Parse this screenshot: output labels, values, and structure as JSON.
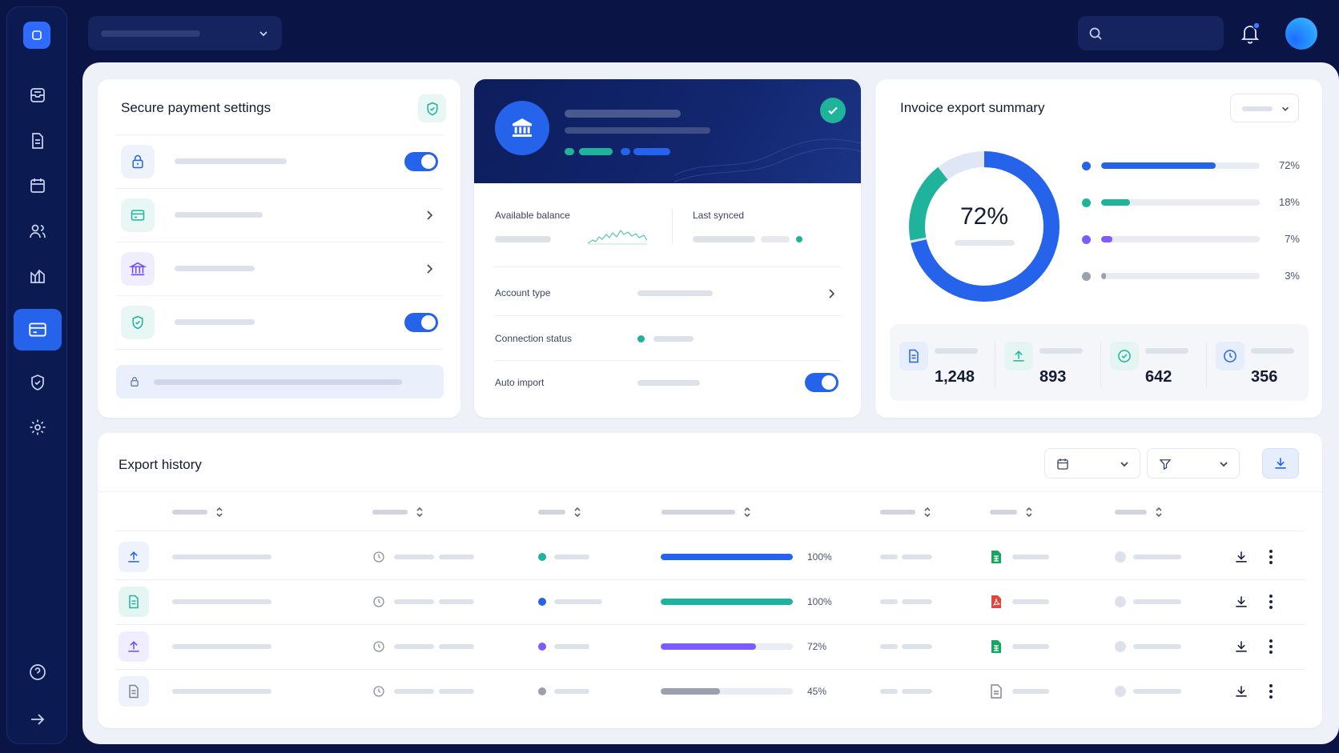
{
  "payment_settings": {
    "title": "Secure payment settings"
  },
  "bank_card": {
    "available_balance_label": "Available balance",
    "last_synced_label": "Last synced",
    "account_type_label": "Account type",
    "connection_status_label": "Connection status",
    "auto_import_label": "Auto import"
  },
  "invoice_summary": {
    "title": "Invoice export summary",
    "center_value": "72%",
    "breakdown": [
      {
        "percent": "72%",
        "value": 72,
        "color": "#2563eb"
      },
      {
        "percent": "18%",
        "value": 18,
        "color": "#20b39b"
      },
      {
        "percent": "7%",
        "value": 7,
        "color": "#7c5cff"
      },
      {
        "percent": "3%",
        "value": 3,
        "color": "#9aa0ae"
      }
    ],
    "stats": [
      {
        "value": "1,248",
        "icon": "document-icon"
      },
      {
        "value": "893",
        "icon": "upload-icon"
      },
      {
        "value": "642",
        "icon": "check-circle-icon"
      },
      {
        "value": "356",
        "icon": "clock-icon"
      }
    ]
  },
  "export_history": {
    "title": "Export history",
    "rows": [
      {
        "progress": "100%",
        "progress_value": 100,
        "color": "#2563eb",
        "status_color": "#20b39b",
        "type_icon": "upload-icon",
        "file_icon": "spreadsheet-icon"
      },
      {
        "progress": "100%",
        "progress_value": 100,
        "color": "#20b39b",
        "status_color": "#2563eb",
        "type_icon": "document-icon",
        "file_icon": "pdf-icon"
      },
      {
        "progress": "72%",
        "progress_value": 72,
        "color": "#7c5cff",
        "status_color": "#7c5cff",
        "type_icon": "upload-icon",
        "file_icon": "spreadsheet-icon"
      },
      {
        "progress": "45%",
        "progress_value": 45,
        "color": "#9aa0ae",
        "status_color": "#9aa0ae",
        "type_icon": "document-icon",
        "file_icon": "file-icon"
      }
    ]
  }
}
